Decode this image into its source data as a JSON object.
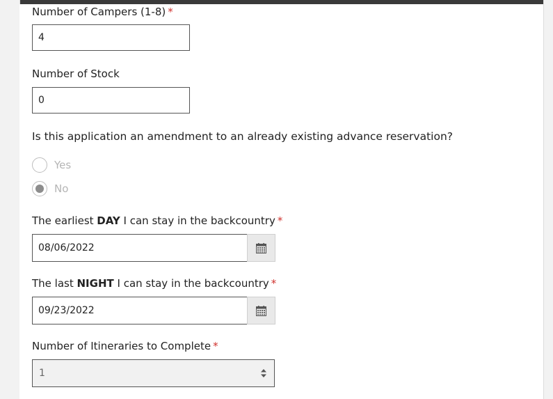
{
  "form": {
    "campers": {
      "label": "Number of Campers (1-8)",
      "required_mark": "*",
      "value": "4"
    },
    "stock": {
      "label": "Number of Stock",
      "value": "0"
    },
    "amendment": {
      "question": "Is this application an amendment to an already existing advance reservation?",
      "options": [
        {
          "label": "Yes",
          "selected": false
        },
        {
          "label": "No",
          "selected": true
        }
      ]
    },
    "earliest_day": {
      "label_prefix": "The earliest ",
      "label_emphasis": "DAY",
      "label_suffix": " I can stay in the backcountry",
      "required_mark": "*",
      "value": "08/06/2022"
    },
    "last_night": {
      "label_prefix": "The last ",
      "label_emphasis": "NIGHT",
      "label_suffix": " I can stay in the backcountry",
      "required_mark": "*",
      "value": "09/23/2022"
    },
    "itineraries": {
      "label": "Number of Itineraries to Complete",
      "required_mark": "*",
      "value": "1"
    }
  },
  "icons": {
    "calendar": "calendar-icon",
    "select_arrows": "sort-arrows-icon"
  }
}
